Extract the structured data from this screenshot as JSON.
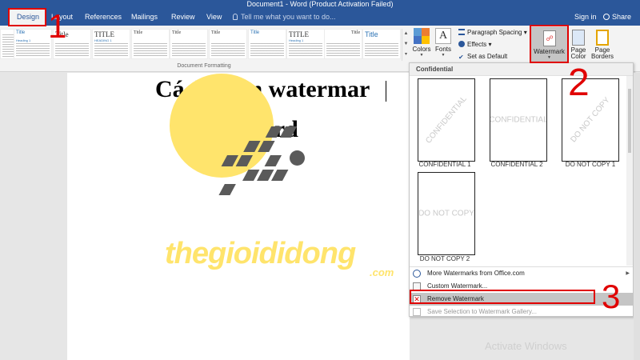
{
  "titlebar": {
    "text": "Document1 - Word (Product Activation Failed)"
  },
  "tabs": [
    {
      "label": "Design",
      "active": true
    },
    {
      "label": "Layout"
    },
    {
      "label": "References"
    },
    {
      "label": "Mailings"
    },
    {
      "label": "Review"
    },
    {
      "label": "View"
    }
  ],
  "tell_me": "Tell me what you want to do...",
  "account": {
    "signin": "Sign in",
    "share": "Share"
  },
  "gallery": {
    "group_label": "Document Formatting",
    "thumbs": [
      {
        "title": "",
        "heading": ""
      },
      {
        "title": "Title",
        "heading": "Heading 1"
      },
      {
        "title": "Title",
        "heading": ""
      },
      {
        "title": "TITLE",
        "heading": "HEADING 1"
      },
      {
        "title": "Title",
        "heading": ""
      },
      {
        "title": "Title",
        "heading": ""
      },
      {
        "title": "Title",
        "heading": ""
      },
      {
        "title": "Title",
        "heading": ""
      },
      {
        "title": "TITLE",
        "heading": "Heading 1"
      },
      {
        "title": "Title",
        "heading": ""
      },
      {
        "title": "Title",
        "heading": ""
      }
    ]
  },
  "commands": {
    "colors": "Colors",
    "fonts": "Fonts",
    "paragraph_spacing": "Paragraph Spacing",
    "effects": "Effects",
    "set_default": "Set as Default",
    "watermark": "Watermark",
    "page_color_line1": "Page",
    "page_color_line2": "Color",
    "page_borders_line1": "Page",
    "page_borders_line2": "Borders"
  },
  "document": {
    "title_line1": "Cách chèn watermar",
    "title_line2": "trong Word",
    "logo_text": "thegioididong",
    "logo_suffix": ".com"
  },
  "dropdown": {
    "header": "Confidential",
    "watermarks": [
      {
        "text": "CONFIDENTIAL",
        "label": "CONFIDENTIAL 1",
        "diagonal": true
      },
      {
        "text": "CONFIDENTIAL",
        "label": "CONFIDENTIAL 2",
        "diagonal": false
      },
      {
        "text": "DO NOT COPY",
        "label": "DO NOT COPY 1",
        "diagonal": true
      },
      {
        "text": "DO NOT COPY",
        "label": "DO NOT COPY 2",
        "diagonal": false
      }
    ],
    "menu": [
      {
        "label": "More Watermarks from Office.com",
        "has_submenu": true
      },
      {
        "label": "Custom Watermark..."
      },
      {
        "label": "Remove Watermark",
        "highlighted": true
      },
      {
        "label": "Save Selection to Watermark Gallery...",
        "disabled": true
      }
    ]
  },
  "annotations": {
    "step1": "1",
    "step2": "2",
    "step3": "3"
  },
  "activate": "Activate Windows",
  "colors": {
    "ribbon_blue": "#2b579a",
    "annotation_red": "#e00000",
    "logo_yellow": "#ffe46c"
  }
}
